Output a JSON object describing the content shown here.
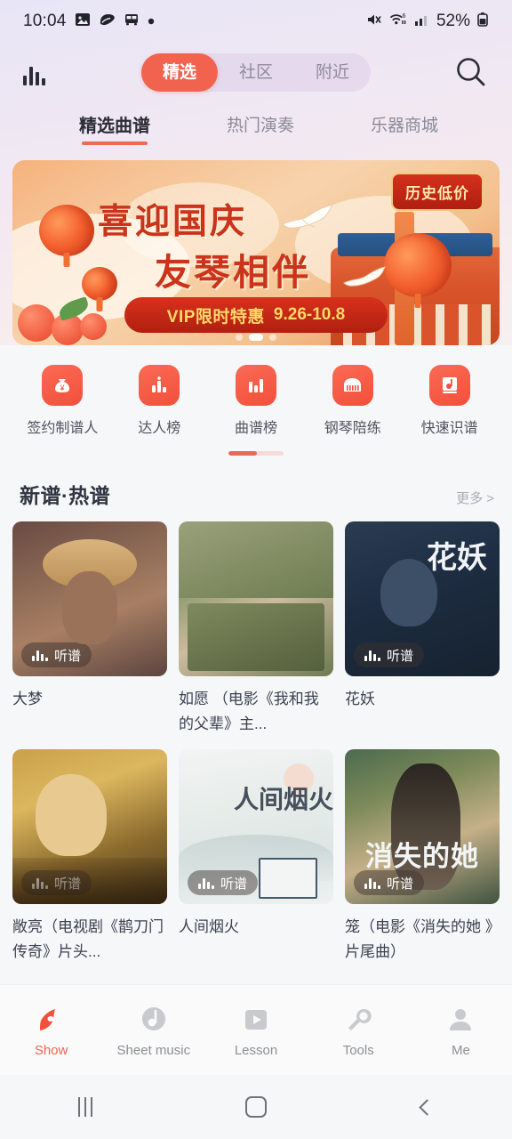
{
  "status_bar": {
    "time": "10:04",
    "battery_percent": "52%",
    "left_icons": [
      "image-icon",
      "blob-icon",
      "bus-icon",
      "dot-icon"
    ],
    "right_icons": [
      "mute-icon",
      "wifi-6-icon",
      "signal-bars-icon",
      "battery-icon"
    ]
  },
  "header": {
    "logo_icon": "bar-chart-logo-icon",
    "search_icon": "search-icon",
    "segments": [
      {
        "label": "精选",
        "active": true
      },
      {
        "label": "社区",
        "active": false
      },
      {
        "label": "附近",
        "active": false
      }
    ]
  },
  "subtabs": [
    {
      "label": "精选曲谱",
      "active": true
    },
    {
      "label": "热门演奏",
      "active": false
    },
    {
      "label": "乐器商城",
      "active": false
    }
  ],
  "banner": {
    "title_line1": "喜迎国庆",
    "title_line2": "友琴相伴",
    "tag": "历史低价",
    "ribbon_text": "VIP限时特惠",
    "ribbon_date": "9.26-10.8",
    "dots": 3,
    "active_dot": 1
  },
  "quick_actions": [
    {
      "label": "签约制谱人",
      "icon": "money-bag-icon"
    },
    {
      "label": "达人榜",
      "icon": "bar-chart-icon"
    },
    {
      "label": "曲谱榜",
      "icon": "bar-chart-icon"
    },
    {
      "label": "钢琴陪练",
      "icon": "piano-icon"
    },
    {
      "label": "快速识谱",
      "icon": "music-book-icon"
    }
  ],
  "section": {
    "title": "新谱·热谱",
    "more": "更多 >"
  },
  "cards": [
    {
      "title": "大梦",
      "badge": "听谱",
      "art": "t1"
    },
    {
      "title": "如愿 （电影《我和我的父辈》主...",
      "badge": "听谱",
      "art": "t2"
    },
    {
      "title": "花妖",
      "badge": "听谱",
      "art": "t3",
      "art_text": "花妖"
    },
    {
      "title": "敞亮（电视剧《鹊刀门传奇》片头...",
      "badge": "听谱",
      "art": "t4"
    },
    {
      "title": "人间烟火",
      "badge": "听谱",
      "art": "t5",
      "art_text": "人间烟火"
    },
    {
      "title": "笼（电影《消失的她 》片尾曲）",
      "badge": "听谱",
      "art": "t6",
      "art_text": "消失的她"
    }
  ],
  "bottom_nav": [
    {
      "label": "Show",
      "icon": "show-icon",
      "active": true
    },
    {
      "label": "Sheet music",
      "icon": "sheet-music-icon",
      "active": false
    },
    {
      "label": "Lesson",
      "icon": "play-square-icon",
      "active": false
    },
    {
      "label": "Tools",
      "icon": "wrench-icon",
      "active": false
    },
    {
      "label": "Me",
      "icon": "person-icon",
      "active": false
    }
  ],
  "system_nav": [
    {
      "name": "recents-button",
      "icon": "recents-icon"
    },
    {
      "name": "home-button",
      "icon": "home-icon"
    },
    {
      "name": "back-button",
      "icon": "back-icon"
    }
  ],
  "colors": {
    "accent": "#f2634f",
    "accent_dark": "#c9341b",
    "text_primary": "#2b2c36",
    "text_muted": "#8b8a97"
  }
}
